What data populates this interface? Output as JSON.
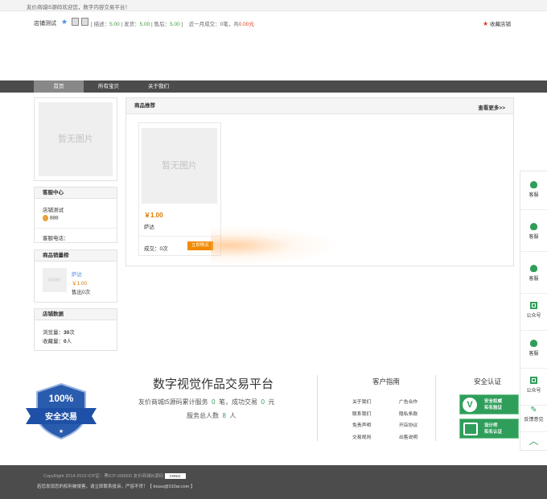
{
  "topbar": {
    "notice": "友价商城t5源码欢迎您，数字内容交易平台！"
  },
  "header": {
    "shop_name": "店铺测试",
    "ratings_open": "[ 描述：",
    "desc_score": "5.00",
    "sep1": " | 发货：",
    "ship_score": "5.00",
    "sep2": " | 售后：",
    "after_score": "5.00",
    "ratings_close": " ]",
    "monthly_prefix": "近一月成交：",
    "monthly_count": "0笔，共",
    "monthly_amount": "0.00元",
    "fav_label": "收藏店铺"
  },
  "nav": {
    "tabs": [
      "首页",
      "所有宝贝",
      "关于我们"
    ],
    "active": 0
  },
  "sidebar": {
    "no_image": "暂无图片",
    "service": {
      "title": "客服中心",
      "shop": "店铺测试",
      "qq": "888",
      "phone_label": "客服电话："
    },
    "ranking": {
      "title": "商品销量榜",
      "item_name": "萨达",
      "item_price": "￥1.00",
      "item_sold": "售出0次",
      "thumb": "暂无图片"
    },
    "stats": {
      "title": "店铺数据",
      "views_label": "浏览量：",
      "views": "30",
      "views_unit": "次",
      "fav_label": "收藏量：",
      "fav": "0",
      "fav_unit": "人"
    }
  },
  "main": {
    "section_title": "商品推荐",
    "more": "查看更多>>",
    "product": {
      "image": "暂无图片",
      "price": "￥1.00",
      "name": "萨达",
      "deals": "成交：0次",
      "buy": "立即购买"
    }
  },
  "footer_info": {
    "badge_pct": "100%",
    "badge_text": "安全交易",
    "platform_title": "数字视觉作品交易平台",
    "stat1_prefix": "友价商城t5源码累计服务",
    "stat1_value": "0",
    "stat1_mid": "笔，成功交易",
    "stat1_value2": "0",
    "stat1_suffix": "元",
    "stat2_prefix": "服务总人数",
    "stat2_value": "8",
    "stat2_suffix": "人",
    "guide_title": "客户指南",
    "links_left": [
      "关于我们",
      "联系我们",
      "免责声明",
      "交易规则"
    ],
    "links_right": [
      "广告合作",
      "隐私条款",
      "开店协议",
      "出售说明"
    ],
    "security_title": "安全认证",
    "cert1": "安全权威\n实名验证",
    "cert2": "设计师\n实名认证"
  },
  "footer": {
    "copyright": "CopyRight 2014-2016 ICP证：黑ICP-000000 友价商城t5源码",
    "cnnic": "CNNIC",
    "notice": "若您发现您的权利被侵害，请立即联系投诉，严惩不贷！【 tousu@010ar.com 】"
  },
  "floatbar": {
    "items": [
      "客服",
      "客服",
      "客服",
      "公众号",
      "客服",
      "公众号",
      "反馈意见"
    ]
  },
  "colors": {
    "accent_green": "#2f9e5a",
    "nav_bg": "#4c4c4c",
    "price": "#e07a00",
    "buy_btn": "#f08a00"
  }
}
